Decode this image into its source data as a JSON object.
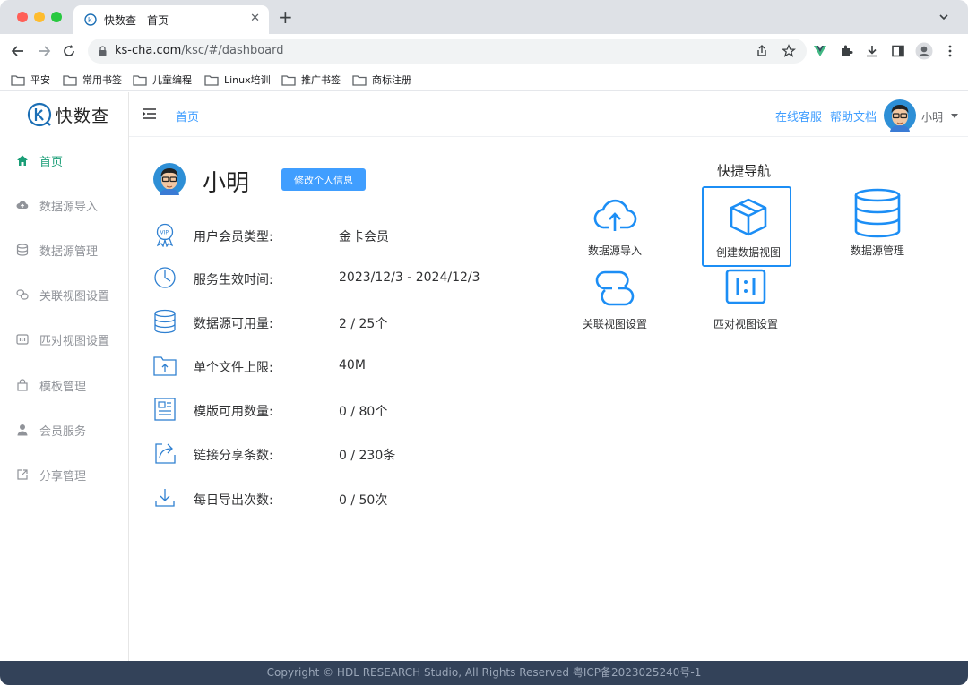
{
  "browser": {
    "tab_title": "快数查 - 首页",
    "url_domain": "ks-cha.com",
    "url_path": "/ksc/#/dashboard",
    "bookmarks": [
      "平安",
      "常用书签",
      "儿童编程",
      "Linux培训",
      "推广书签",
      "商标注册"
    ]
  },
  "app": {
    "logo_text": "快数查",
    "sidebar": [
      {
        "label": "首页",
        "icon": "home-icon",
        "active": true
      },
      {
        "label": "数据源导入",
        "icon": "cloud-upload-icon"
      },
      {
        "label": "数据源管理",
        "icon": "database-icon"
      },
      {
        "label": "关联视图设置",
        "icon": "link-icon"
      },
      {
        "label": "匹对视图设置",
        "icon": "compare-icon"
      },
      {
        "label": "模板管理",
        "icon": "bag-icon"
      },
      {
        "label": "会员服务",
        "icon": "user-icon"
      },
      {
        "label": "分享管理",
        "icon": "share-icon"
      }
    ],
    "header": {
      "breadcrumb": "首页",
      "online_service": "在线客服",
      "help_docs": "帮助文档",
      "username": "小明"
    },
    "profile": {
      "name": "小明",
      "edit_button": "修改个人信息",
      "rows": [
        {
          "label": "用户会员类型:",
          "value": "金卡会员",
          "icon": "vip-badge-icon"
        },
        {
          "label": "服务生效时间:",
          "value": "2023/12/3 - 2024/12/3",
          "icon": "clock-icon"
        },
        {
          "label": "数据源可用量:",
          "value": "2 / 25个",
          "icon": "database-icon"
        },
        {
          "label": "单个文件上限:",
          "value": "40M",
          "icon": "folder-upload-icon"
        },
        {
          "label": "模版可用数量:",
          "value": "0 / 80个",
          "icon": "template-icon"
        },
        {
          "label": "链接分享条数:",
          "value": "0 / 230条",
          "icon": "share-link-icon"
        },
        {
          "label": "每日导出次数:",
          "value": "0 / 50次",
          "icon": "download-icon"
        }
      ]
    },
    "quick_nav": {
      "title": "快捷导航",
      "items": [
        {
          "label": "数据源导入",
          "icon": "cloud-upload-icon"
        },
        {
          "label": "创建数据视图",
          "icon": "cube-icon"
        },
        {
          "label": "数据源管理",
          "icon": "database-icon"
        },
        {
          "label": "关联视图设置",
          "icon": "link-icon"
        },
        {
          "label": "匹对视图设置",
          "icon": "compare-icon"
        }
      ]
    },
    "footer": "Copyright © HDL RESEARCH Studio, All Rights Reserved    粤ICP备2023025240号-1"
  },
  "colors": {
    "accent": "#409eff",
    "active_menu": "#1a9e77",
    "icon_blue": "#1c8ef5",
    "footer_bg": "#334259"
  }
}
